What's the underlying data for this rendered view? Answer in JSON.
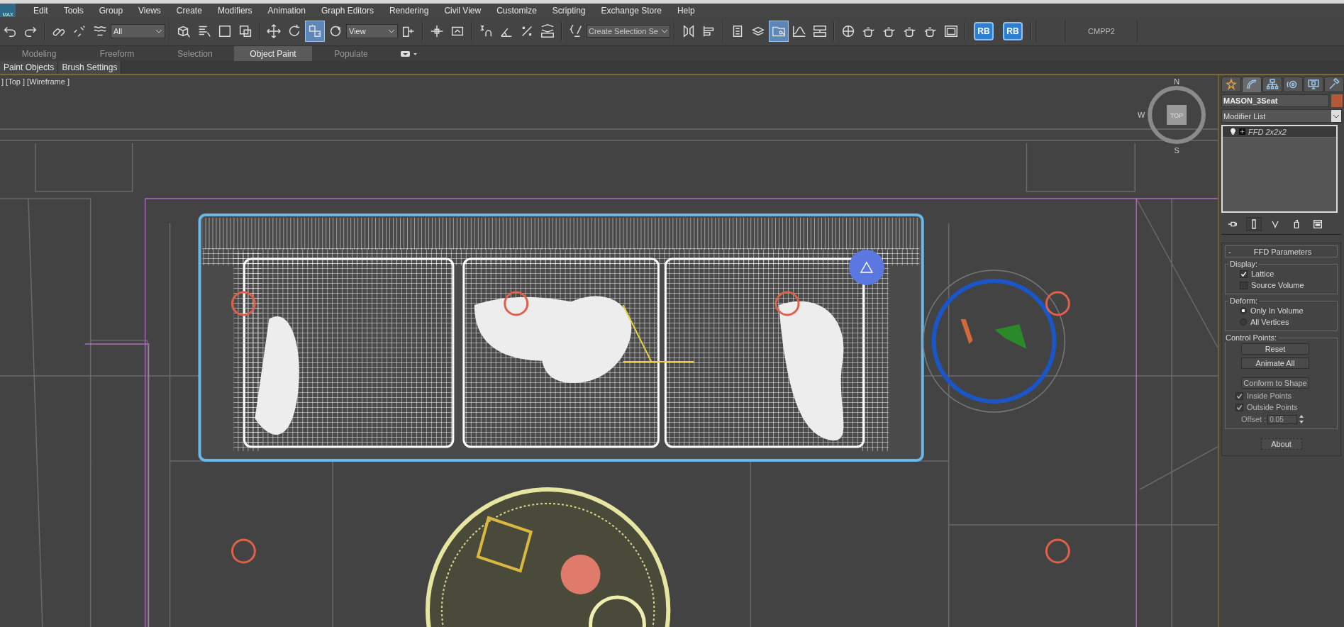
{
  "app_logo": "MAX",
  "menu": [
    "Edit",
    "Tools",
    "Group",
    "Views",
    "Create",
    "Modifiers",
    "Animation",
    "Graph Editors",
    "Rendering",
    "Civil View",
    "Customize",
    "Scripting",
    "Exchange Store",
    "Help"
  ],
  "toolbar": {
    "selection_filter": "All",
    "reference_coordinate": "View",
    "named_selection_placeholder": "Create Selection Se",
    "tools": [
      {
        "active": false
      },
      {
        "active": false
      },
      {
        "active": false
      },
      {
        "active": false
      },
      {
        "active": false
      },
      {
        "active": false
      },
      {
        "active": false
      },
      {
        "active": false
      },
      {
        "active": false
      },
      {
        "active": false
      },
      {
        "active": false
      },
      {
        "active": true
      },
      {
        "active": false
      },
      {
        "active": false
      },
      {
        "active": false
      },
      {
        "active": false
      },
      {
        "active": false
      },
      {
        "active": false
      },
      {
        "active": false
      },
      {
        "active": false
      },
      {
        "active": false
      },
      {
        "active": false
      },
      {
        "active": false
      },
      {
        "active": false
      },
      {
        "active": false
      },
      {
        "active": true
      },
      {
        "active": false
      },
      {
        "active": false
      },
      {
        "active": false
      },
      {
        "active": false
      },
      {
        "active": false
      },
      {
        "active": false
      },
      {
        "active": false
      },
      {
        "active": false
      }
    ],
    "custom_buttons": [
      "RB",
      "RB"
    ],
    "custom_label": "CMPP2"
  },
  "ribbon": {
    "tabs": [
      {
        "label": "Modeling",
        "selected": false
      },
      {
        "label": "Freeform",
        "selected": false
      },
      {
        "label": "Selection",
        "selected": false
      },
      {
        "label": "Object Paint",
        "selected": true
      },
      {
        "label": "Populate",
        "selected": false
      }
    ],
    "panels": [
      "Paint Objects",
      "Brush Settings"
    ]
  },
  "viewport": {
    "label": "] [Top ] [Wireframe ]",
    "viewcube": {
      "top": "TOP",
      "north": "N",
      "west": "W",
      "south": "S"
    }
  },
  "command_panel": {
    "tabs": [
      {
        "selected": false
      },
      {
        "selected": true
      },
      {
        "selected": false
      },
      {
        "selected": false
      },
      {
        "selected": false
      },
      {
        "selected": false
      }
    ],
    "object_name": "MASON_3Seat",
    "swatch": {
      "color": "#b4583a"
    },
    "modifier_list": "Modifier List",
    "stack": [
      {
        "label": "FFD 2x2x2",
        "selected": true
      }
    ],
    "rollout": {
      "collapse": "-",
      "title": "FFD Parameters",
      "display": {
        "title": "Display:",
        "options": [
          {
            "label": "Lattice",
            "checked": true
          },
          {
            "label": "Source Volume",
            "checked": false
          }
        ]
      },
      "deform": {
        "title": "Deform:",
        "options": [
          {
            "label": "Only In Volume",
            "selected": true
          },
          {
            "label": "All Vertices",
            "selected": false
          }
        ]
      },
      "control_points": {
        "title": "Control Points:",
        "buttons": [
          "Reset",
          "Animate All",
          "Conform to Shape"
        ],
        "options": [
          {
            "label": "Inside Points",
            "checked": true
          },
          {
            "label": "Outside Points",
            "checked": true
          }
        ],
        "offset_label": "Offset :",
        "offset_value": "0.05"
      },
      "about": "About"
    }
  }
}
